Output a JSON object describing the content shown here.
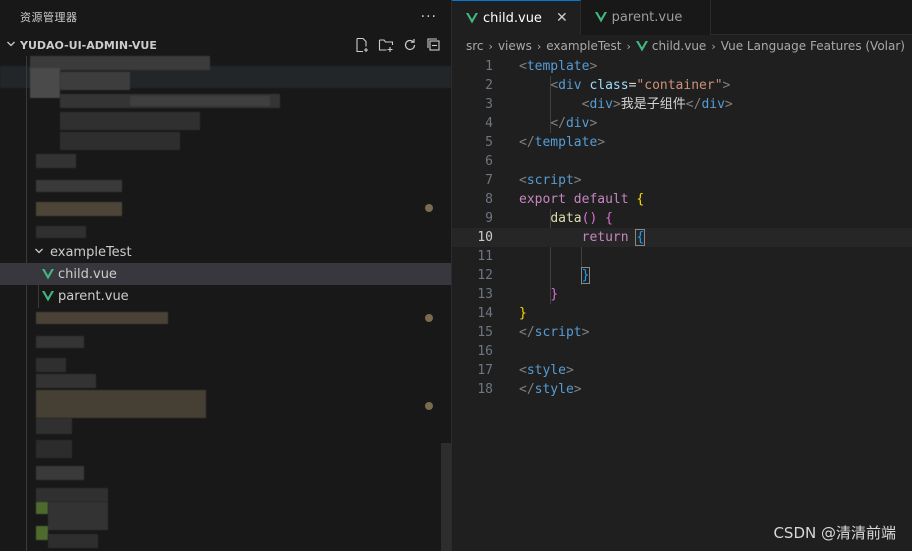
{
  "sidebar": {
    "title": "资源管理器",
    "more": "···",
    "project": "YUDAO-UI-ADMIN-VUE",
    "folder": "exampleTest",
    "files": [
      "child.vue",
      "parent.vue"
    ]
  },
  "tabs": [
    {
      "label": "child.vue",
      "close": "✕"
    },
    {
      "label": "parent.vue"
    }
  ],
  "breadcrumb": [
    "src",
    "views",
    "exampleTest",
    "child.vue",
    "Vue Language Features (Volar)"
  ],
  "code_line_numbers": [
    "1",
    "2",
    "3",
    "4",
    "5",
    "6",
    "7",
    "8",
    "9",
    "10",
    "11",
    "12",
    "13",
    "14",
    "15",
    "16",
    "17",
    "18"
  ],
  "watermark": "CSDN @清清前端",
  "colors": {
    "accent": "#0078d4",
    "vue": "#41b883"
  }
}
